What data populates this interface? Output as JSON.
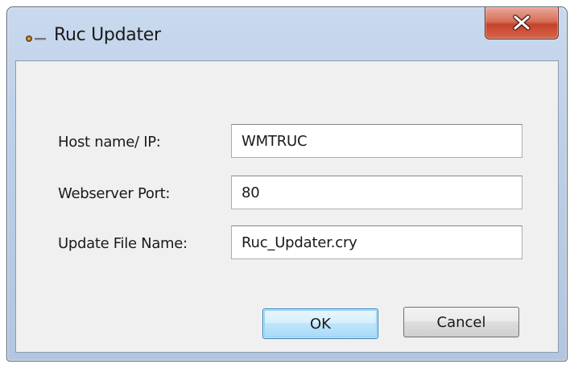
{
  "window": {
    "title": "Ruc Updater",
    "close_label": "x"
  },
  "form": {
    "host": {
      "label": "Host name/ IP:",
      "value": "WMTRUC"
    },
    "port": {
      "label": "Webserver Port:",
      "value": "80"
    },
    "file": {
      "label": "Update File Name:",
      "value": "Ruc_Updater.cry"
    }
  },
  "buttons": {
    "ok_label": "OK",
    "cancel_label": "Cancel"
  },
  "icons": {
    "app": "app-icon",
    "close": "close-icon"
  },
  "colors": {
    "titlebar": "#bccfe7",
    "close_button": "#c4422a",
    "client_background": "#f0f0f0",
    "default_button_border": "#3c7fb1"
  }
}
